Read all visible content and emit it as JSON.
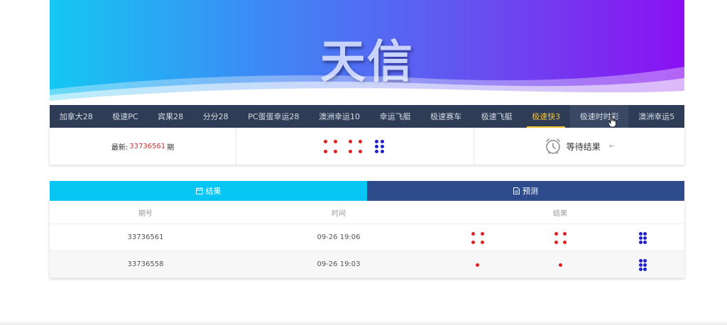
{
  "banner": {
    "logo_text": "天信"
  },
  "nav": {
    "items": [
      {
        "label": "加拿大28"
      },
      {
        "label": "极速PC"
      },
      {
        "label": "宾果28"
      },
      {
        "label": "分分28"
      },
      {
        "label": "PC蛋蛋幸运28"
      },
      {
        "label": "澳洲幸运10"
      },
      {
        "label": "幸运飞艇"
      },
      {
        "label": "极速赛车"
      },
      {
        "label": "极速飞艇"
      },
      {
        "label": "极速快3"
      },
      {
        "label": "极速时时彩"
      },
      {
        "label": "澳洲幸运5"
      }
    ],
    "active_label": "极速快3",
    "hover_label": "极速时时彩"
  },
  "latest": {
    "prefix": "最新:",
    "issue_number": "33736561",
    "suffix": "期",
    "dice": [
      4,
      4,
      6
    ],
    "status_text": "等待结果",
    "status_arrow": "←"
  },
  "tabs": {
    "results_label": "结果",
    "predict_label": "预测"
  },
  "table": {
    "headers": {
      "issue": "期号",
      "time": "时间",
      "result": "结果"
    },
    "rows": [
      {
        "issue": "33736561",
        "time": "09-26 19:06",
        "dice": [
          4,
          4,
          6
        ]
      },
      {
        "issue": "33736558",
        "time": "09-26 19:03",
        "dice": [
          1,
          1,
          6
        ]
      }
    ]
  },
  "colors": {
    "dice_red": "#e02020",
    "dice_blue": "#2020c8",
    "nav_bg": "#2f3c55",
    "nav_active": "#f5c234",
    "tab_results": "#08c6f4",
    "tab_predict": "#2e4b8c",
    "issue_highlight": "#d23232"
  }
}
